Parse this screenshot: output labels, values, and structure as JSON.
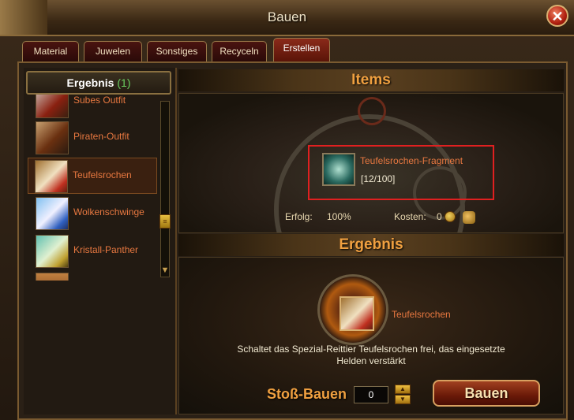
{
  "window": {
    "title": "Bauen"
  },
  "tabs": [
    {
      "label": "Material"
    },
    {
      "label": "Juwelen"
    },
    {
      "label": "Sonstiges"
    },
    {
      "label": "Recyceln"
    },
    {
      "label": "Erstellen",
      "active": true
    }
  ],
  "left_panel": {
    "header_label": "Ergebnis",
    "header_count": "(1)",
    "items": [
      {
        "label": "Subes Outfit"
      },
      {
        "label": "Piraten-Outfit"
      },
      {
        "label": "Teufelsrochen",
        "selected": true
      },
      {
        "label": "Wolkenschwinge"
      },
      {
        "label": "Kristall-Panther"
      }
    ]
  },
  "items_section": {
    "title": "Items",
    "material": {
      "name": "Teufelsrochen-Fragment",
      "count": "[12/100]"
    },
    "success_label": "Erfolg:",
    "success_value": "100%",
    "cost_label": "Kosten:",
    "cost_value": "0"
  },
  "result_section": {
    "title": "Ergebnis",
    "item_name": "Teufelsrochen",
    "description_line1": "Schaltet das Spezial-Reittier Teufelsrochen frei, das eingesetzte",
    "description_line2": "Helden verstärkt"
  },
  "footer": {
    "batch_label": "Stoß-Bauen",
    "batch_value": "0",
    "build_label": "Bauen"
  },
  "colors": {
    "accent_orange": "#f0a040",
    "item_name": "#e87840",
    "highlight_red": "#e02020",
    "count_green": "#6ad060"
  }
}
